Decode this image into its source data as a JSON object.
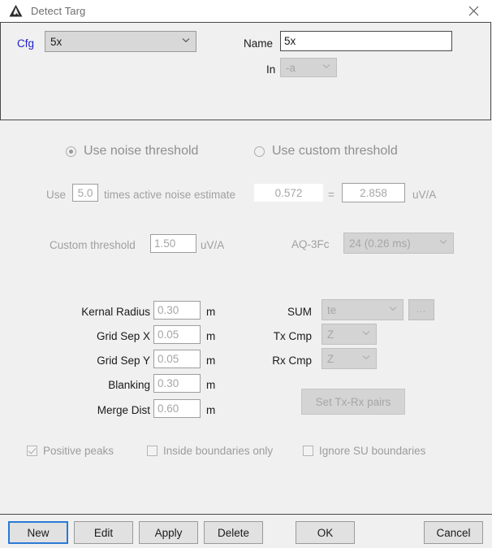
{
  "window": {
    "title": "Detect Targ",
    "app_icon": "mountain-triangle-icon",
    "close_icon": "close-icon"
  },
  "config_group": {
    "cfg_label": "Cfg",
    "cfg_value": "5x",
    "name_label": "Name",
    "name_value": "5x",
    "in_label": "In",
    "in_value": "-a"
  },
  "threshold": {
    "noise_radio_label": "Use noise threshold",
    "custom_radio_label": "Use custom threshold",
    "noise_selected": true,
    "use_label": "Use",
    "multiplier_value": "5.0",
    "times_label": "times active noise estimate",
    "noise_estimate_value": "0.572",
    "equals_label": "=",
    "result_value": "2.858",
    "result_units": "uV/A",
    "custom_threshold_label": "Custom threshold",
    "custom_threshold_value": "1.50",
    "custom_threshold_units": "uV/A",
    "aq3fc_label": "AQ-3Fc",
    "aq3fc_value": "24  (0.26 ms)"
  },
  "params_left": [
    {
      "label": "Kernal Radius",
      "value": "0.30",
      "units": "m"
    },
    {
      "label": "Grid Sep X",
      "value": "0.05",
      "units": "m"
    },
    {
      "label": "Grid Sep Y",
      "value": "0.05",
      "units": "m"
    },
    {
      "label": "Blanking",
      "value": "0.30",
      "units": "m"
    },
    {
      "label": "Merge Dist",
      "value": "0.60",
      "units": "m"
    }
  ],
  "params_right": {
    "sum_label": "SUM",
    "sum_value": "te",
    "sum_more_label": "...",
    "tx_cmp_label": "Tx Cmp",
    "tx_cmp_value": "Z",
    "rx_cmp_label": "Rx Cmp",
    "rx_cmp_value": "Z",
    "set_pairs_label": "Set Tx-Rx pairs"
  },
  "checkboxes": [
    {
      "label": "Positive peaks",
      "checked": true
    },
    {
      "label": "Inside boundaries only",
      "checked": false
    },
    {
      "label": "Ignore SU boundaries",
      "checked": false
    }
  ],
  "footer": {
    "new_label": "New",
    "edit_label": "Edit",
    "apply_label": "Apply",
    "delete_label": "Delete",
    "ok_label": "OK",
    "cancel_label": "Cancel"
  }
}
